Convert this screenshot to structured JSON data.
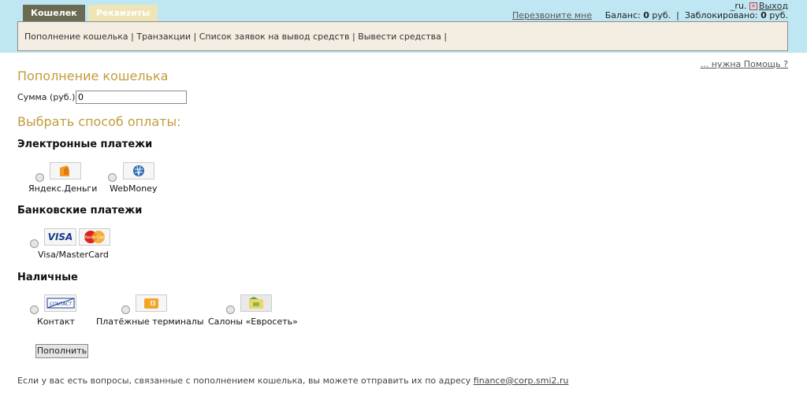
{
  "tabs": [
    {
      "label": "Кошелек",
      "active": true
    },
    {
      "label": "Реквизиты",
      "active": false
    }
  ],
  "header": {
    "user": "_ru.",
    "logout": "Выход",
    "callback": "Перезвоните мне",
    "balance_label": "Баланс:",
    "balance_value": "0",
    "currency": "руб.",
    "separator": "|",
    "blocked_label": "Заблокировано:",
    "blocked_value": "0",
    "currency2": "руб."
  },
  "subnav": {
    "items": [
      "Пополнение кошелька",
      "Транзакции",
      "Список заявок на вывод средств",
      "Вывести средства"
    ],
    "sep": "|"
  },
  "help": "... нужна Помощь ?",
  "page_title": "Пополнение кошелька",
  "sum": {
    "label": "Сумма (руб.):",
    "value": "0"
  },
  "choose_title": "Выбрать способ оплаты:",
  "sections": {
    "electronic": {
      "title": "Электронные платежи",
      "options": [
        "Яндекс.Деньги",
        "WebMoney"
      ]
    },
    "bank": {
      "title": "Банковские платежи",
      "options": [
        "Visa/MasterCard"
      ],
      "logo_visa": "VISA",
      "logo_mc": "MasterCard"
    },
    "cash": {
      "title": "Наличные",
      "options": [
        "Контакт",
        "Платёжные терминалы",
        "Салоны «Евросеть»"
      ],
      "logo_contact": "CONTACT"
    }
  },
  "submit": "Пополнить",
  "footer": {
    "text": "Если у вас есть вопросы, связанные с пополнением кошелька, вы можете отправить их по адресу",
    "email": "finance@corp.smi2.ru"
  },
  "colors": {
    "topbar": "#bfe7f3",
    "tab_active": "#6b6b52",
    "tab_inactive": "#efe4b5",
    "title": "#c49b3c"
  }
}
